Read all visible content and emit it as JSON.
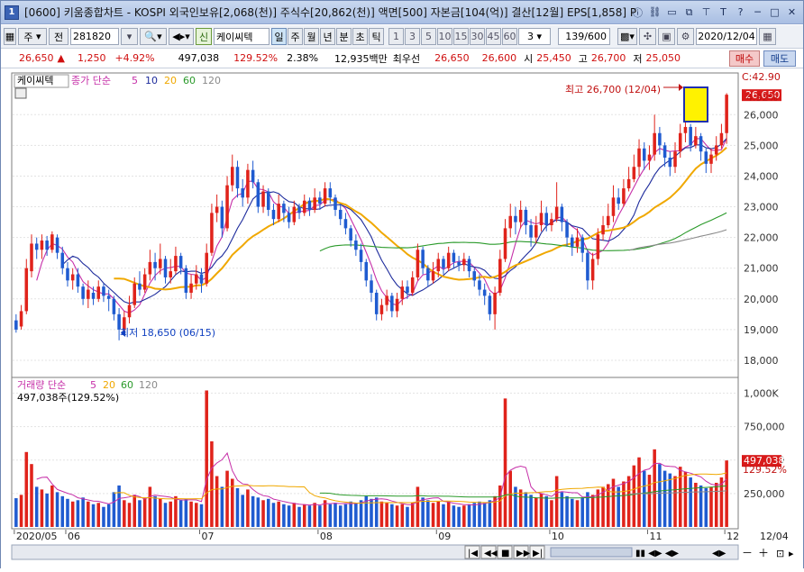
{
  "title": {
    "num": "1",
    "text": "[0600] 키움종합차트 - KOSPI 외국인보유[2,068(천)] 주식수[20,862(천)] 액면[500] 자본금[104(억)] 결산[12월] EPS[1,858] P"
  },
  "titlebar_icons": [
    "info-icon",
    "link-icon",
    "window-icon",
    "copy-icon",
    "pin-icon",
    "text-icon",
    "help-icon",
    "minimize-icon",
    "maximize-icon",
    "close-icon"
  ],
  "toolbar": {
    "period": "주",
    "prev": "전",
    "code": "281820",
    "name_badge": "신",
    "name": "케이씨텍",
    "tabs": [
      "일",
      "주",
      "월",
      "년",
      "분",
      "초",
      "틱"
    ],
    "nums": [
      "1",
      "3",
      "5",
      "10",
      "15",
      "30",
      "45",
      "60"
    ],
    "count": "3",
    "range": "139/600",
    "date": "2020/12/04"
  },
  "info": {
    "price": "26,650",
    "change": "1,250",
    "pct": "+4.92%",
    "volume": "497,038",
    "vol_pct": "129.52%",
    "turnover": "2.38%",
    "amount": "12,935백만",
    "pri_label": "최우선",
    "best_ask": "26,650",
    "best_bid": "26,600",
    "open_label": "시",
    "open": "25,450",
    "high_label": "고",
    "high": "26,700",
    "low_label": "저",
    "low": "25,050",
    "buy": "매수",
    "sell": "매도"
  },
  "price_panel": {
    "legend_name": "케이씨텍",
    "legend_ma": "종가 단순",
    "ma_periods": [
      "5",
      "10",
      "20",
      "60",
      "120"
    ],
    "max_label": "최고 26,700 (12/04)",
    "min_label": "최저 18,650 (06/15)",
    "c_label": "C:42.90",
    "cur_price": "26,650",
    "cur_pct": "4.92%",
    "y_ticks": [
      "26,000",
      "25,000",
      "24,000",
      "23,000",
      "22,000",
      "21,000",
      "20,000",
      "19,000",
      "18,000"
    ]
  },
  "volume_panel": {
    "legend": "거래량 단순",
    "ma_periods": [
      "5",
      "20",
      "60",
      "120"
    ],
    "value_label": "497,038주(129.52%)",
    "y_ticks": [
      "1,000K",
      "750,000",
      "500,000",
      "250,000"
    ],
    "cur_value": "497,038",
    "cur_pct": "129.52%"
  },
  "x_axis": {
    "labels": [
      "2020/05",
      "06",
      "07",
      "08",
      "09",
      "10",
      "11",
      "12"
    ],
    "right_label": "12/04"
  },
  "colors": {
    "up": "#e0231b",
    "down": "#1f5bd0",
    "ma5": "#c62fa8",
    "ma10": "#1d2b9c",
    "ma20": "#f0a800",
    "ma60": "#2a9a2a",
    "ma120": "#8a8a8a"
  },
  "chart_data": {
    "type": "candlestick",
    "ylim": [
      17500,
      27300
    ],
    "vol_ylim": [
      0,
      1050000
    ],
    "candles": [
      [
        19300,
        19000,
        19500,
        18900,
        215000
      ],
      [
        19100,
        19600,
        19800,
        19000,
        240000
      ],
      [
        19600,
        21000,
        21300,
        19500,
        560000
      ],
      [
        20900,
        21800,
        22100,
        20700,
        470000
      ],
      [
        21800,
        21600,
        22000,
        21300,
        300000
      ],
      [
        21600,
        21900,
        22100,
        21300,
        280000
      ],
      [
        21900,
        21600,
        22050,
        21400,
        250000
      ],
      [
        21600,
        22100,
        22200,
        21500,
        310000
      ],
      [
        22000,
        21500,
        22100,
        21300,
        260000
      ],
      [
        21500,
        21000,
        21700,
        20800,
        230000
      ],
      [
        21000,
        20600,
        21200,
        20400,
        210000
      ],
      [
        20600,
        20800,
        21000,
        20300,
        190000
      ],
      [
        20800,
        20400,
        21000,
        20200,
        200000
      ],
      [
        20400,
        20000,
        20500,
        19800,
        220000
      ],
      [
        20000,
        20300,
        20600,
        19700,
        190000
      ],
      [
        20200,
        20000,
        20400,
        19800,
        170000
      ],
      [
        20000,
        20400,
        20600,
        19900,
        180000
      ],
      [
        20400,
        20100,
        20500,
        19900,
        150000
      ],
      [
        20100,
        20000,
        20300,
        19600,
        170000
      ],
      [
        20000,
        19500,
        20100,
        19300,
        260000
      ],
      [
        19500,
        19000,
        19700,
        18650,
        310000
      ],
      [
        19000,
        19400,
        19600,
        18800,
        200000
      ],
      [
        19400,
        19800,
        20100,
        19200,
        180000
      ],
      [
        19800,
        20500,
        20700,
        19700,
        240000
      ],
      [
        20500,
        20300,
        20900,
        20100,
        200000
      ],
      [
        20300,
        20800,
        21000,
        20200,
        220000
      ],
      [
        20800,
        21200,
        21600,
        20600,
        300000
      ],
      [
        21200,
        21000,
        21500,
        20600,
        230000
      ],
      [
        21000,
        21300,
        21800,
        20800,
        210000
      ],
      [
        21300,
        20700,
        21400,
        20500,
        180000
      ],
      [
        20700,
        20900,
        21300,
        20500,
        190000
      ],
      [
        20900,
        21400,
        21700,
        20800,
        230000
      ],
      [
        21400,
        21000,
        21500,
        20800,
        200000
      ],
      [
        21000,
        20200,
        21100,
        20000,
        210000
      ],
      [
        20200,
        20500,
        20800,
        20000,
        190000
      ],
      [
        20500,
        20800,
        21100,
        20300,
        180000
      ],
      [
        20800,
        20500,
        21000,
        20200,
        170000
      ],
      [
        20500,
        21500,
        21800,
        20400,
        1020000
      ],
      [
        21500,
        22800,
        23100,
        21400,
        640000
      ],
      [
        22800,
        23000,
        23400,
        22500,
        380000
      ],
      [
        23000,
        22300,
        23200,
        22000,
        300000
      ],
      [
        22300,
        23700,
        24000,
        22200,
        420000
      ],
      [
        23700,
        24300,
        24700,
        23500,
        360000
      ],
      [
        24300,
        23600,
        24500,
        23300,
        290000
      ],
      [
        23600,
        23300,
        23900,
        23000,
        240000
      ],
      [
        23300,
        24200,
        24400,
        23100,
        280000
      ],
      [
        24200,
        23800,
        24500,
        23600,
        230000
      ],
      [
        23800,
        23000,
        23900,
        22800,
        220000
      ],
      [
        23000,
        23500,
        23700,
        22800,
        200000
      ],
      [
        23500,
        22900,
        23600,
        22700,
        210000
      ],
      [
        22900,
        22600,
        23100,
        22400,
        180000
      ],
      [
        22600,
        23100,
        23400,
        22500,
        190000
      ],
      [
        23100,
        22800,
        23200,
        22500,
        170000
      ],
      [
        22800,
        22500,
        23000,
        22300,
        160000
      ],
      [
        22500,
        23000,
        23200,
        22400,
        180000
      ],
      [
        23000,
        22800,
        23100,
        22600,
        150000
      ],
      [
        22800,
        23200,
        23400,
        22700,
        170000
      ],
      [
        23200,
        22900,
        23300,
        22700,
        160000
      ],
      [
        22900,
        23300,
        23600,
        22800,
        180000
      ],
      [
        23300,
        23100,
        23500,
        22900,
        160000
      ],
      [
        23100,
        23600,
        23800,
        23000,
        200000
      ],
      [
        23600,
        23300,
        23800,
        23100,
        170000
      ],
      [
        23300,
        22900,
        23400,
        22700,
        180000
      ],
      [
        22900,
        22600,
        23100,
        22400,
        160000
      ],
      [
        22600,
        22300,
        22800,
        22100,
        170000
      ],
      [
        22300,
        21900,
        22400,
        21700,
        190000
      ],
      [
        21900,
        21600,
        22100,
        21400,
        180000
      ],
      [
        21600,
        21200,
        21800,
        20900,
        200000
      ],
      [
        21200,
        20600,
        21300,
        20400,
        230000
      ],
      [
        20600,
        20200,
        20800,
        19900,
        210000
      ],
      [
        20200,
        19500,
        20300,
        19300,
        220000
      ],
      [
        19500,
        19800,
        20000,
        19300,
        190000
      ],
      [
        19800,
        20100,
        20300,
        19600,
        180000
      ],
      [
        20100,
        19600,
        20200,
        19400,
        170000
      ],
      [
        19600,
        20000,
        20200,
        19400,
        160000
      ],
      [
        20000,
        20400,
        20600,
        19800,
        170000
      ],
      [
        20400,
        20200,
        20600,
        20000,
        150000
      ],
      [
        20200,
        20700,
        20900,
        20100,
        180000
      ],
      [
        20700,
        21600,
        21800,
        20600,
        300000
      ],
      [
        21600,
        21000,
        21700,
        20800,
        220000
      ],
      [
        21000,
        20600,
        21100,
        20400,
        200000
      ],
      [
        20600,
        20900,
        21200,
        20500,
        180000
      ],
      [
        20900,
        21300,
        21500,
        20700,
        190000
      ],
      [
        21300,
        21000,
        21400,
        20800,
        170000
      ],
      [
        21000,
        21500,
        21700,
        20900,
        190000
      ],
      [
        21500,
        21200,
        21600,
        21000,
        160000
      ],
      [
        21200,
        21100,
        21400,
        20900,
        150000
      ],
      [
        21100,
        21300,
        21500,
        20900,
        160000
      ],
      [
        21300,
        20900,
        21400,
        20700,
        170000
      ],
      [
        20900,
        20600,
        21000,
        20400,
        180000
      ],
      [
        20600,
        20300,
        20800,
        20100,
        190000
      ],
      [
        20300,
        20100,
        20500,
        19800,
        180000
      ],
      [
        20100,
        19500,
        20200,
        19300,
        200000
      ],
      [
        19500,
        20200,
        20400,
        19000,
        230000
      ],
      [
        20200,
        21300,
        21600,
        20100,
        310000
      ],
      [
        21300,
        22300,
        22600,
        21200,
        960000
      ],
      [
        22300,
        22700,
        23100,
        22000,
        420000
      ],
      [
        22700,
        22500,
        23000,
        22100,
        300000
      ],
      [
        22500,
        22900,
        23200,
        22300,
        280000
      ],
      [
        22900,
        22400,
        23000,
        22100,
        260000
      ],
      [
        22400,
        22000,
        22600,
        21700,
        240000
      ],
      [
        22000,
        22400,
        22700,
        21800,
        220000
      ],
      [
        22400,
        22800,
        23200,
        22200,
        250000
      ],
      [
        22800,
        22400,
        23000,
        22200,
        230000
      ],
      [
        22400,
        22600,
        22800,
        22200,
        200000
      ],
      [
        22600,
        23000,
        23800,
        22500,
        380000
      ],
      [
        23000,
        22500,
        23100,
        22200,
        260000
      ],
      [
        22500,
        22000,
        22600,
        21700,
        230000
      ],
      [
        22000,
        21700,
        22100,
        21400,
        210000
      ],
      [
        21700,
        22000,
        22300,
        21500,
        200000
      ],
      [
        22000,
        21500,
        22100,
        21200,
        220000
      ],
      [
        21500,
        20600,
        21600,
        20300,
        260000
      ],
      [
        20600,
        21300,
        21500,
        20300,
        240000
      ],
      [
        21300,
        22100,
        22300,
        21100,
        280000
      ],
      [
        22100,
        22400,
        22700,
        21900,
        300000
      ],
      [
        22400,
        22700,
        23100,
        22300,
        320000
      ],
      [
        22700,
        23300,
        23700,
        22500,
        360000
      ],
      [
        23300,
        23100,
        23600,
        22900,
        300000
      ],
      [
        23100,
        23600,
        23900,
        23000,
        340000
      ],
      [
        23600,
        23900,
        24300,
        23500,
        380000
      ],
      [
        23900,
        24300,
        24700,
        23800,
        460000
      ],
      [
        24300,
        24900,
        25200,
        24000,
        520000
      ],
      [
        24900,
        24500,
        25100,
        24200,
        420000
      ],
      [
        24500,
        24700,
        25000,
        24200,
        390000
      ],
      [
        24700,
        25400,
        26000,
        24500,
        580000
      ],
      [
        25400,
        25000,
        25600,
        24700,
        470000
      ],
      [
        25000,
        24600,
        25100,
        24300,
        420000
      ],
      [
        24600,
        24300,
        24800,
        24000,
        400000
      ],
      [
        24300,
        24800,
        25100,
        24100,
        380000
      ],
      [
        24800,
        25400,
        25700,
        24600,
        450000
      ],
      [
        25400,
        25600,
        25900,
        25100,
        410000
      ],
      [
        25600,
        25000,
        25700,
        24800,
        370000
      ],
      [
        25000,
        25300,
        25600,
        24900,
        330000
      ],
      [
        25300,
        24800,
        25400,
        24500,
        310000
      ],
      [
        24800,
        24400,
        24900,
        24100,
        290000
      ],
      [
        24400,
        24700,
        24900,
        24100,
        300000
      ],
      [
        24700,
        25000,
        25300,
        24500,
        330000
      ],
      [
        25000,
        25400,
        25700,
        24900,
        370000
      ],
      [
        25400,
        26650,
        26700,
        25050,
        497038
      ]
    ],
    "ma": {
      "5": [],
      "10": [],
      "20": [],
      "60": [],
      "120": []
    }
  }
}
